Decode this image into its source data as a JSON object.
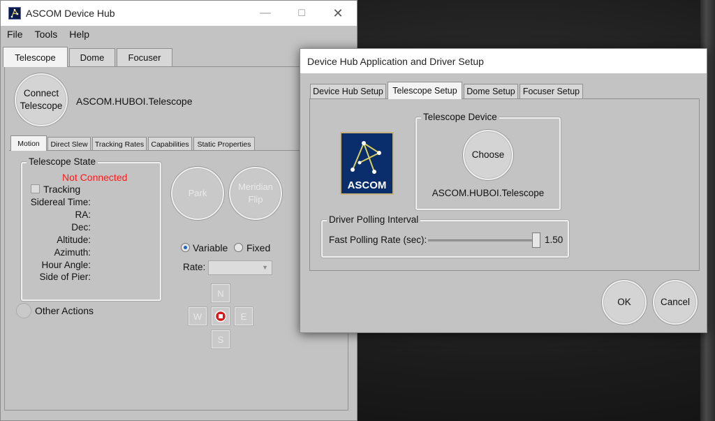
{
  "main_window": {
    "title": "ASCOM Device Hub",
    "menu": [
      "File",
      "Tools",
      "Help"
    ],
    "tabs": [
      "Telescope",
      "Dome",
      "Focuser"
    ],
    "connect_button": "Connect Telescope",
    "device_id": "ASCOM.HUBOI.Telescope",
    "subtabs": [
      "Motion",
      "Direct Slew",
      "Tracking Rates",
      "Capabilities",
      "Static Properties"
    ],
    "telescope_state": {
      "title": "Telescope State",
      "status": "Not Connected",
      "tracking_label": "Tracking",
      "fields": [
        "Sidereal Time:",
        "RA:",
        "Dec:",
        "Altitude:",
        "Azimuth:",
        "Hour Angle:",
        "Side of Pier:"
      ]
    },
    "park_button": "Park",
    "meridian_flip_button": "Meridian Flip",
    "rate_mode": {
      "variable": "Variable",
      "fixed": "Fixed",
      "selected": "Variable"
    },
    "rate_label": "Rate:",
    "directions": {
      "north": "N",
      "south": "S",
      "east": "E",
      "west": "W"
    },
    "other_actions": "Other Actions",
    "status_color": "#ff1a1a"
  },
  "dialog": {
    "title": "Device Hub Application and Driver Setup",
    "tabs": [
      "Device Hub Setup",
      "Telescope Setup",
      "Dome Setup",
      "Focuser Setup"
    ],
    "active_tab": "Telescope Setup",
    "telescope_device": {
      "title": "Telescope Device",
      "choose_button": "Choose",
      "device_id": "ASCOM.HUBOI.Telescope",
      "logo_text": "ASCOM"
    },
    "polling": {
      "title": "Driver Polling Interval",
      "label": "Fast Polling Rate (sec):",
      "value": "1.50",
      "slider_fraction": 0.97
    },
    "ok_button": "OK",
    "cancel_button": "Cancel"
  }
}
